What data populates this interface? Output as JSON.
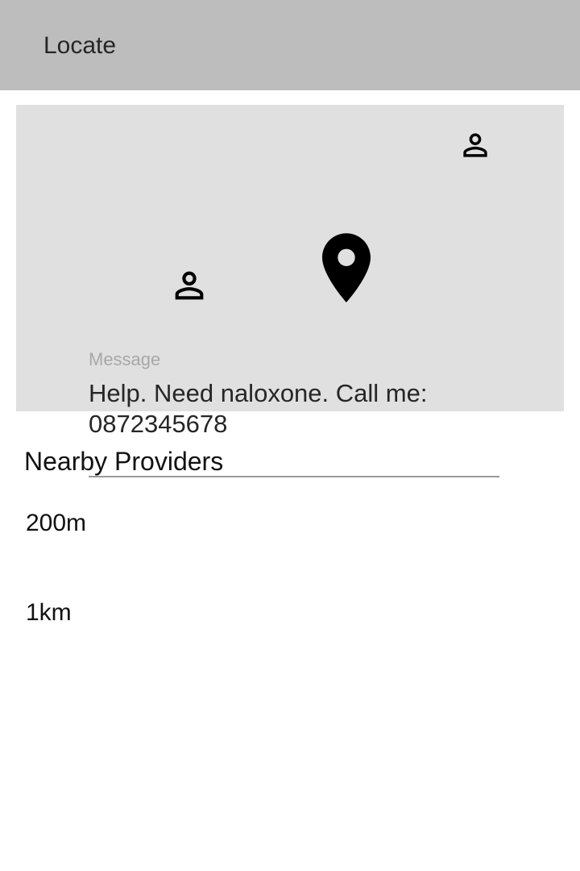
{
  "appbar": {
    "title": "Locate"
  },
  "map": {
    "markers": [
      {
        "icon": "person-icon"
      },
      {
        "icon": "person-icon"
      },
      {
        "icon": "location-pin-icon"
      }
    ]
  },
  "message": {
    "label": "Message",
    "value": "Help. Need naloxone. Call me: 0872345678"
  },
  "providers": {
    "title": "Nearby Providers",
    "items": [
      {
        "distance": "200m"
      },
      {
        "distance": "1km"
      }
    ]
  },
  "colors": {
    "appbar_bg": "#bdbdbd",
    "map_bg": "#e0e0e0",
    "icon": "#000000"
  }
}
